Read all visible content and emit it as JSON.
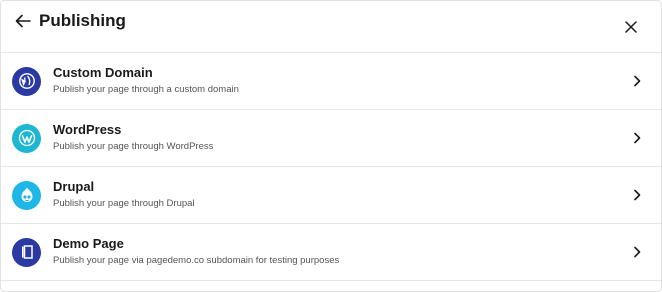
{
  "header": {
    "title": "Publishing",
    "back_icon": "arrow-left-icon",
    "close_icon": "close-icon"
  },
  "items": [
    {
      "title": "Custom Domain",
      "subtitle": "Publish your page through a custom domain",
      "icon": "custom-domain-icon",
      "icon_color": "#2b3aa3"
    },
    {
      "title": "WordPress",
      "subtitle": "Publish your page through WordPress",
      "icon": "wordpress-icon",
      "icon_color": "#1fb6d4"
    },
    {
      "title": "Drupal",
      "subtitle": "Publish your page through Drupal",
      "icon": "drupal-icon",
      "icon_color": "#1fb6e8"
    },
    {
      "title": "Demo Page",
      "subtitle": "Publish your page via pagedemo.co subdomain for testing purposes",
      "icon": "demo-page-icon",
      "icon_color": "#2b3aa3"
    }
  ]
}
